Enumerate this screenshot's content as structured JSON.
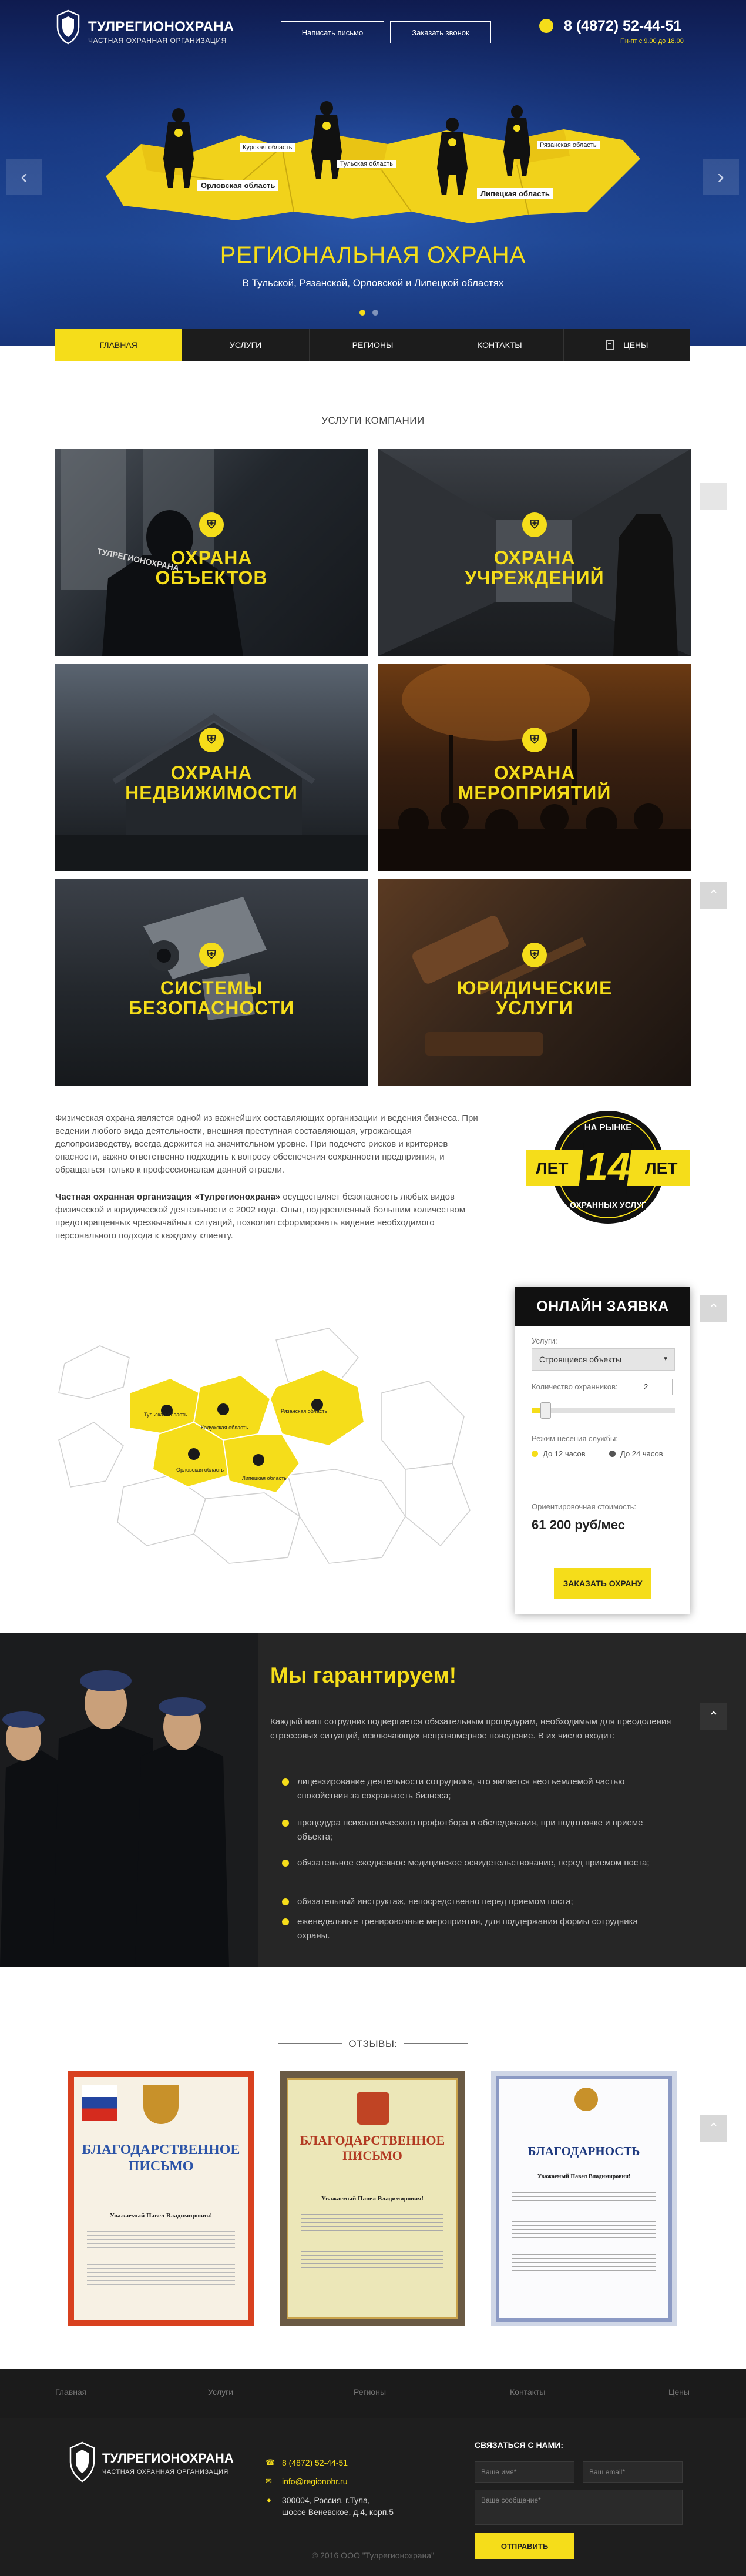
{
  "header": {
    "brand_title": "ТУЛРЕГИОНОХРАНА",
    "brand_subtitle": "ЧАСТНАЯ ОХРАННАЯ ОРГАНИЗАЦИЯ",
    "btn_write": "Написать письмо",
    "btn_call": "Заказать звонок",
    "phone": "8 (4872) 52-44-51",
    "hours": "Пн-пт с 9.00 до 18.00"
  },
  "hero": {
    "title": "РЕГИОНАЛЬНАЯ ОХРАНА",
    "subtitle": "В Тульской, Рязанской, Орловской и Липецкой областях",
    "map_labels": [
      "Орловская область",
      "Курская область",
      "Тульская область",
      "Рязанская область",
      "Липецкая область"
    ],
    "prev_arrow": "‹",
    "next_arrow": "›"
  },
  "nav": {
    "items": [
      "ГЛАВНАЯ",
      "УСЛУГИ",
      "РЕГИОНЫ",
      "КОНТАКТЫ",
      "ЦЕНЫ"
    ],
    "active": "ГЛАВНАЯ"
  },
  "services": {
    "section_title": "УСЛУГИ КОМПАНИИ",
    "tiles": [
      {
        "line1": "ОХРАНА",
        "line2": "ОБЪЕКТОВ",
        "patch": "ТУЛРЕГИОНОХРАНА"
      },
      {
        "line1": "ОХРАНА",
        "line2": "УЧРЕЖДЕНИЙ"
      },
      {
        "line1": "ОХРАНА",
        "line2": "НЕДВИЖИМОСТИ"
      },
      {
        "line1": "ОХРАНА",
        "line2": "МЕРОПРИЯТИЙ"
      },
      {
        "line1": "СИСТЕМЫ",
        "line2": "БЕЗОПАСНОСТИ"
      },
      {
        "line1": "ЮРИДИЧЕСКИЕ",
        "line2": "УСЛУГИ"
      }
    ]
  },
  "about": {
    "p1": "Физическая охрана является одной из важнейших составляющих организации и ведения бизнеса. При ведении любого вида деятельности, внешняя преступная составляющая, угрожающая делопроизводству, всегда держится на значительном уровне. При подсчете рисков и критериев опасности, важно ответственно подходить к вопросу обеспечения сохранности предприятия, и обращаться только к профессионалам данной отрасли.",
    "p2_bold": "Частная охранная организация «Тулрегионохрана»",
    "p2_rest": " осуществляет безопасность любых видов физической и юридической деятельности с 2002 года. Опыт, подкрепленный большим количеством предотвращенных чрезвычайных ситуаций, позволил сформировать видение необходимого персонального подхода к каждому клиенту.",
    "badge_top": "НА РЫНКЕ",
    "badge_num": "14",
    "badge_left": "ЛЕТ",
    "badge_right": "ЛЕТ",
    "badge_bottom": "ОХРАННЫХ УСЛУГ"
  },
  "map2": {
    "labels": [
      "Тульская область",
      "Рязанская область",
      "Калужская область",
      "Орловская область",
      "Липецкая область"
    ]
  },
  "order": {
    "title": "ОНЛАЙН ЗАЯВКА",
    "service_label": "Услуги:",
    "service_value": "Строящиеся объекты",
    "guards_label": "Количество охранников:",
    "guards_value": "2",
    "mode_label": "Режим несения службы:",
    "mode_12": "До 12 часов",
    "mode_24": "До 24 часов",
    "price_label": "Ориентировочная стоимость:",
    "price_value": "61 200 руб/мес",
    "submit": "ЗАКАЗАТЬ ОХРАНУ",
    "guards_slider_fraction": 0.1
  },
  "guarantee": {
    "title": "Мы гарантируем!",
    "intro": "Каждый наш сотрудник подвергается обязательным процедурам, необходимым для преодоления стрессовых ситуаций, исключающих неправомерное поведение. В их число входит:",
    "items": [
      "лицензирование деятельности сотрудника, что является неотъемлемой частью спокойствия за сохранность бизнеса;",
      "процедура психологического профотбора и обследования, при подготовке и приеме объекта;",
      "обязательное ежедневное медицинское освидетельствование, перед приемом поста;",
      "обязательный инструктаж, непосредственно перед приемом поста;",
      "еженедельные тренировочные мероприятия, для поддержания формы сотрудника охраны."
    ]
  },
  "reviews": {
    "section_title": "ОТЗЫВЫ:",
    "certs": [
      {
        "title": "БЛАГОДАРСТВЕННОЕ ПИСЬМО",
        "greeting": "Уважаемый Павел Владимирович!"
      },
      {
        "title": "БЛАГОДАРСТВЕННОЕ ПИСЬМО",
        "greeting": "Уважаемый Павел Владимирович!"
      },
      {
        "title": "БЛАГОДАРНОСТЬ",
        "greeting": "Уважаемый Павел Владимирович!"
      }
    ]
  },
  "footer": {
    "nav": [
      "Главная",
      "Услуги",
      "Регионы",
      "Контакты",
      "Цены"
    ],
    "phone": "8 (4872) 52-44-51",
    "email": "info@regionohr.ru",
    "address_line1": "300004, Россия, г.Тула,",
    "address_line2": "шоссе Веневское, д.4, корп.5",
    "contact_title": "СВЯЗАТЬСЯ С НАМИ:",
    "name_placeholder": "Ваше имя*",
    "email_placeholder": "Ваш email*",
    "msg_placeholder": "Ваше сообщение*",
    "send": "ОТПРАВИТЬ",
    "copyright": "© 2016 ООО \"Тулрегионохрана\""
  },
  "scroll_up": "⌃",
  "colors": {
    "accent": "#f5dd1a",
    "dark": "#1c1c1c",
    "hero_blue": "#1f4a9a"
  }
}
